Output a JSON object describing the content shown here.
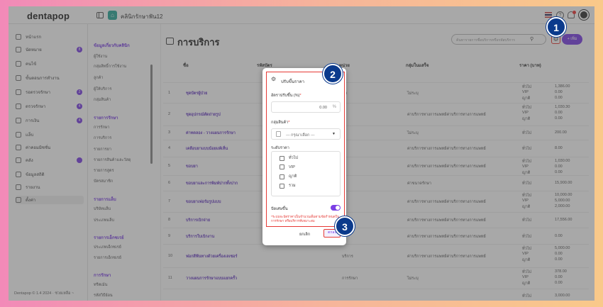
{
  "app": {
    "logo": "dentapop",
    "clinic_name": "คลินิกรักษาฟัน12",
    "footer": "Dentapop © 1.4 2024  ·  ช่วยเหลือ ~"
  },
  "sidebar": {
    "items": [
      {
        "label": "หน้าแรก"
      },
      {
        "label": "นัดหมาย",
        "badge": "8"
      },
      {
        "label": "คนไข้"
      },
      {
        "label": "ขั้นตอนการทำงาน"
      },
      {
        "label": "รอตรวจรักษา",
        "badge": "2"
      },
      {
        "label": "ตรวจรักษา",
        "badge": "4"
      },
      {
        "label": "การเงิน",
        "badge": "4"
      },
      {
        "label": "แล็บ"
      },
      {
        "label": "ค่าคอมมิชชั่น"
      },
      {
        "label": "คลัง",
        "badge": ""
      },
      {
        "label": "ข้อมูลสถิติ"
      },
      {
        "label": "รายงาน"
      },
      {
        "label": "ตั้งค่า"
      }
    ]
  },
  "submenu": {
    "sections": [
      {
        "heading": "ข้อมูลเกี่ยวกับคลินิก",
        "items": [
          "ผู้ใช้งาน",
          "กลุ่มสิทธิ์การใช้งาน",
          "ลูกค้า",
          "ผู้ให้บริการ",
          "กลุ่มสินค้า"
        ]
      },
      {
        "heading": "รายการรักษา",
        "items": [
          "การรักษา",
          "การบริการ",
          "รายการยา",
          "รายการสินค้าและวัสดุ",
          "รายการสูตร",
          "บัตรสมาชิก"
        ]
      },
      {
        "heading": "รายการแล็บ",
        "items": [
          "บริษัทแล็บ",
          "ประเภทแล็บ"
        ]
      },
      {
        "heading": "รายการเอ็กซเรย์",
        "items": [
          "ประเภทเอ็กซเรย์",
          "รายการเอ็กซเรย์"
        ]
      },
      {
        "heading": "การรักษา",
        "items": [
          "ทรีตเม้น",
          "รหัสวิธีย้อน"
        ]
      }
    ]
  },
  "main": {
    "title": "การบริการ",
    "search_placeholder": "ค้นหารายการชื่อบริการหรือรหัสบริการ",
    "add_label": "+ เพิ่ม",
    "columns": {
      "no": "",
      "name": "ชื่อ",
      "code": "รหัสบัตร",
      "unit": "หน่วย",
      "group": "กลุ่มในแสร็จ",
      "price": "ราคา (บาท)"
    },
    "rows": [
      {
        "no": "1",
        "name": "ชุดบัตรผู้ป่วย",
        "unit": "ชุด",
        "group": "ไม่ระบุ",
        "prices": [
          [
            "ทั่วไป",
            "1,386.00"
          ],
          [
            "VIP",
            "0.00"
          ],
          [
            "ญาติ",
            "0.00"
          ]
        ]
      },
      {
        "no": "2",
        "name": "ชุดอุปกรณ์ตัดถ่ายรูป",
        "unit": "",
        "group": "ค่าบริการทางการแพทย์ค่าบริการทางการแพทย์",
        "prices": [
          [
            "ทั่วไป",
            "1,030.30"
          ],
          [
            "VIP",
            "0.00"
          ],
          [
            "ญาติ",
            "0.00"
          ]
        ]
      },
      {
        "no": "3",
        "name": "ค่าทดลอง - วางแผนการรักษา",
        "unit": "",
        "group": "ไม่ระบุ",
        "prices": [
          [
            "ทั่วไป",
            "200.00"
          ]
        ]
      },
      {
        "no": "4",
        "name": "เคลือบยาแบบน้อยแพ้เห็น",
        "unit": "",
        "group": "ค่าบริการทางการแพทย์ค่าบริการทางการแพทย์",
        "prices": [
          [
            "ทั่วไป",
            "8.00"
          ]
        ]
      },
      {
        "no": "5",
        "name": "ขอบยา",
        "unit": "",
        "group": "ค่าบริการทางการแพทย์ค่าบริการทางการแพทย์",
        "prices": [
          [
            "ทั่วไป",
            "1,030.00"
          ],
          [
            "VIP",
            "0.00"
          ],
          [
            "ญาติ",
            "0.00"
          ]
        ]
      },
      {
        "no": "6",
        "name": "ขอบยาและการพิมพ์ปากทั้งปาก",
        "unit": "",
        "group": "ค่าขนาดรักษา",
        "prices": [
          [
            "ทั่วไป",
            "15,900.00"
          ]
        ]
      },
      {
        "no": "7",
        "name": "ขอบยาเฟอร์มรูปแบบ",
        "unit": "",
        "group": "ค่าบริการทางการแพทย์ค่าบริการทางการแพทย์",
        "prices": [
          [
            "ทั่วไป",
            "10,000.00"
          ],
          [
            "VIP",
            "5,000.00"
          ],
          [
            "ญาติ",
            "2,000.00"
          ]
        ]
      },
      {
        "no": "8",
        "name": "บริการเบิกจ่าย",
        "unit": "",
        "group": "ค่าบริการทางการแพทย์ค่าบริการทางการแพทย์",
        "prices": [
          [
            "ทั่วไป",
            "17,556.00"
          ]
        ]
      },
      {
        "no": "9",
        "name": "บริการใบเบิกงาน",
        "unit": "",
        "group": "ค่าบริการทางการแพทย์ค่าบริการทางการแพทย์",
        "prices": [
          [
            "ทั่วไป",
            "0.00"
          ]
        ]
      },
      {
        "no": "10",
        "name": "ฟอกสีฟันทางด้วยเครื่องเลเซอร์",
        "unit": "บริการ",
        "group": "ค่าบริการทางการแพทย์ค่าบริการทางการแพทย์",
        "prices": [
          [
            "ทั่วไป",
            "5,000.00"
          ],
          [
            "VIP",
            "0.00"
          ],
          [
            "ญาติ",
            "0.00"
          ]
        ]
      },
      {
        "no": "11",
        "name": "วางแผนการรักษาแบบแยกครั้ว",
        "unit": "การรักษา",
        "group": "ไม่ระบุ",
        "prices": [
          [
            "ทั่วไป",
            "378.00"
          ],
          [
            "VIP",
            "0.00"
          ],
          [
            "ญาติ",
            "0.00"
          ]
        ]
      },
      {
        "no": "",
        "name": "",
        "unit": "",
        "group": "",
        "prices": [
          [
            "ทั่วไป",
            "3,000.00"
          ]
        ]
      }
    ]
  },
  "modal": {
    "title": "ปรับขึ้นราคา",
    "percent_label": "อัตราปรับขึ้น (%)",
    "percent_value": "0.00",
    "percent_unit": "%",
    "group_label": "กลุ่มสินค้า",
    "group_placeholder": "--- กรุณาเลือก ---",
    "price_level_label": "ระดับราคา",
    "levels": [
      "ทั่วไป",
      "VIP",
      "ญาติ",
      "รวม"
    ],
    "toggle_label": "ปัดเศษขึ้น",
    "toggle_on": true,
    "note": "*ระบบจะปัดราคาเป็นจำนวนเต็มตามข้อกำหนดในการรักษา หรือบริการที่เหมาะสม",
    "cancel_label": "ยกเลิก",
    "save_label": "ตกลง"
  },
  "callouts": [
    "1",
    "2",
    "3"
  ],
  "colors": {
    "accent": "#7b3fe4",
    "highlight": "#e53935",
    "callout": "#0b3a8c"
  }
}
